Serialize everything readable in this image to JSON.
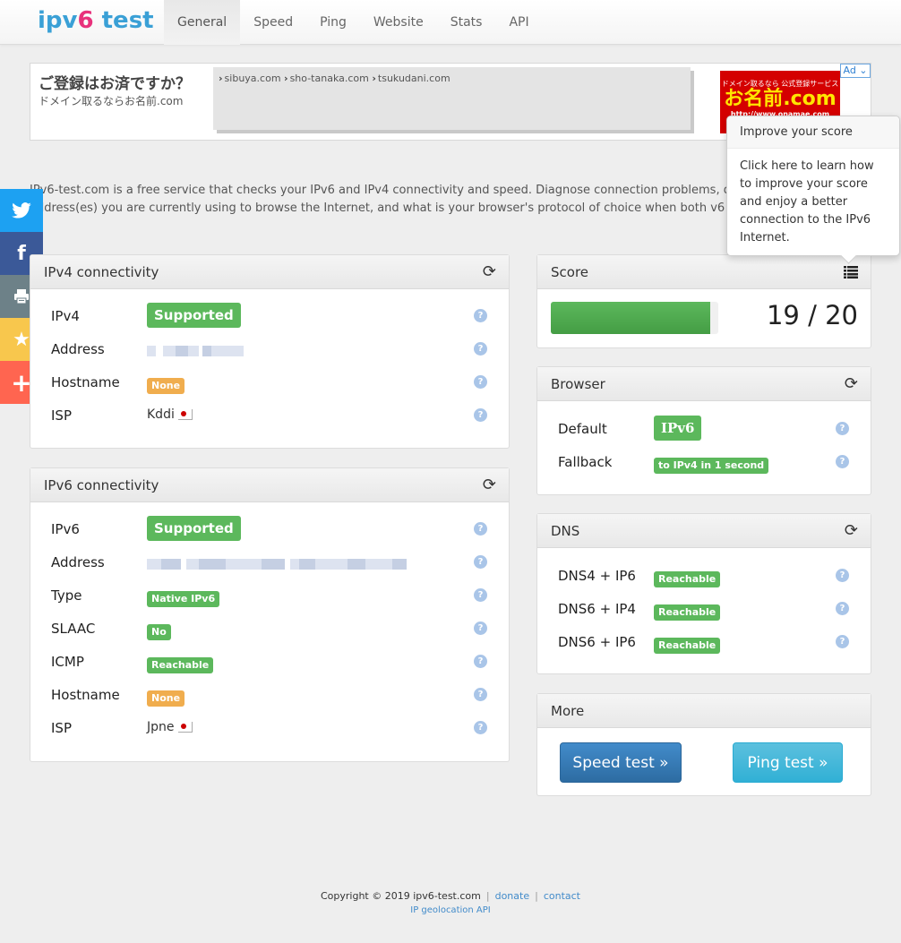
{
  "brand": {
    "prefix": "ipv",
    "six": "6",
    "suffix": " test"
  },
  "nav": [
    {
      "label": "General",
      "active": true
    },
    {
      "label": "Speed"
    },
    {
      "label": "Ping"
    },
    {
      "label": "Website"
    },
    {
      "label": "Stats"
    },
    {
      "label": "API"
    }
  ],
  "ad": {
    "headline": "ご登録はお済ですか？",
    "sub": "ドメイン取るならお名前.com",
    "links": [
      "sibuya.com",
      "sho-tanaka.com",
      "tsukudani.com"
    ],
    "banner": {
      "line1": "ドメイン取るなら 公式登録サービス",
      "line2": "お名前.com",
      "line3": "http://www.onamae.com"
    },
    "badge": "Ad ⌄"
  },
  "description": {
    "line1": "IPv6-test.com is a free service that checks your IPv6 and IPv4 connectivity and speed. Diagnose connection problems, d",
    "line2": "address(es) you are currently using to browse the Internet, and what is your browser's protocol of choice when both v6"
  },
  "social": [
    {
      "name": "twitter",
      "glyph": "🐦"
    },
    {
      "name": "facebook",
      "glyph": "f"
    },
    {
      "name": "print",
      "glyph": "⎙"
    },
    {
      "name": "favorite",
      "glyph": "★"
    },
    {
      "name": "more",
      "glyph": "+"
    }
  ],
  "ipv4": {
    "title": "IPv4 connectivity",
    "rows": {
      "ipv4": {
        "label": "IPv4",
        "value": "Supported"
      },
      "address": {
        "label": "Address"
      },
      "hostname": {
        "label": "Hostname",
        "value": "None"
      },
      "isp": {
        "label": "ISP",
        "value": "Kddi"
      }
    }
  },
  "ipv6": {
    "title": "IPv6 connectivity",
    "rows": {
      "ipv6": {
        "label": "IPv6",
        "value": "Supported"
      },
      "address": {
        "label": "Address"
      },
      "type": {
        "label": "Type",
        "value": "Native IPv6"
      },
      "slaac": {
        "label": "SLAAC",
        "value": "No"
      },
      "icmp": {
        "label": "ICMP",
        "value": "Reachable"
      },
      "hostname": {
        "label": "Hostname",
        "value": "None"
      },
      "isp": {
        "label": "ISP",
        "value": "Jpne"
      }
    }
  },
  "score": {
    "title": "Score",
    "value": 19,
    "max": 20,
    "text": "19 / 20",
    "fraction": 0.95
  },
  "popover": {
    "title": "Improve your score",
    "body": "Click here to learn how to improve your score and enjoy a better connection to the IPv6 Internet."
  },
  "browser": {
    "title": "Browser",
    "default": {
      "label": "Default",
      "value": "IPv6"
    },
    "fallback": {
      "label": "Fallback",
      "value": "to IPv4 in 1 second"
    }
  },
  "dns": {
    "title": "DNS",
    "rows": [
      {
        "label": "DNS4 + IP6",
        "value": "Reachable"
      },
      {
        "label": "DNS6 + IP4",
        "value": "Reachable"
      },
      {
        "label": "DNS6 + IP6",
        "value": "Reachable"
      }
    ]
  },
  "more": {
    "title": "More",
    "speed": "Speed test »",
    "ping": "Ping test »"
  },
  "help_glyph": "?",
  "footer": {
    "copyright": "Copyright © 2019 ipv6-test.com",
    "sep": "|",
    "donate": "donate",
    "contact": "contact",
    "geo": "IP geolocation API"
  },
  "colors": {
    "success": "#5cb85c",
    "warning": "#f0ad4e",
    "primary": "#428bca",
    "info": "#5bc0de",
    "brand_blue": "#3aa0d6",
    "brand_pink": "#e8327c"
  }
}
